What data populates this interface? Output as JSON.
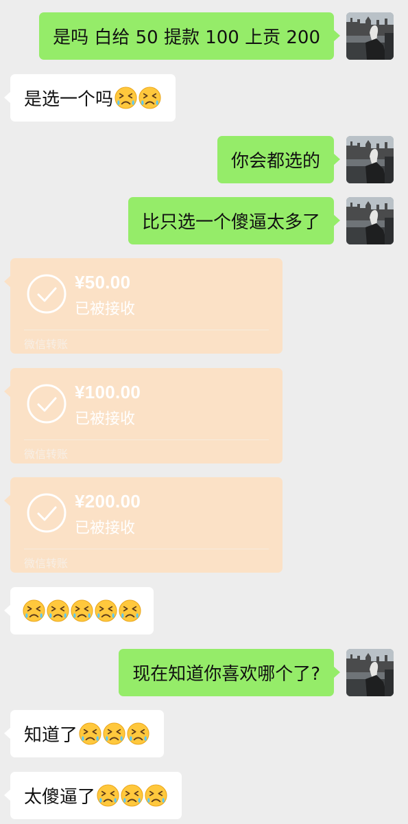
{
  "messages": {
    "m1": {
      "text": "是吗 白给 50 提款 100 上贡 200"
    },
    "m2": {
      "text": "是选一个吗"
    },
    "m3": {
      "text": "你会都选的"
    },
    "m4": {
      "text": "比只选一个傻逼太多了"
    },
    "m5": {
      "text": ""
    },
    "m6": {
      "text": "现在知道你喜欢哪个了?"
    },
    "m7": {
      "text": "知道了"
    },
    "m8": {
      "text": "太傻逼了"
    }
  },
  "transfers": [
    {
      "amount": "¥50.00",
      "status": "已被接收",
      "footer": "微信转账"
    },
    {
      "amount": "¥100.00",
      "status": "已被接收",
      "footer": "微信转账"
    },
    {
      "amount": "¥200.00",
      "status": "已被接收",
      "footer": "微信转账"
    }
  ],
  "icons": {
    "emoji": "tired-face-emoji-icon",
    "transfer_status": "check-circle-icon",
    "avatar": "profile-photo-avatar"
  },
  "colors": {
    "background": "#ededed",
    "my_bubble": "#95ec69",
    "their_bubble": "#ffffff",
    "transfer_card": "#fbe1c6"
  }
}
